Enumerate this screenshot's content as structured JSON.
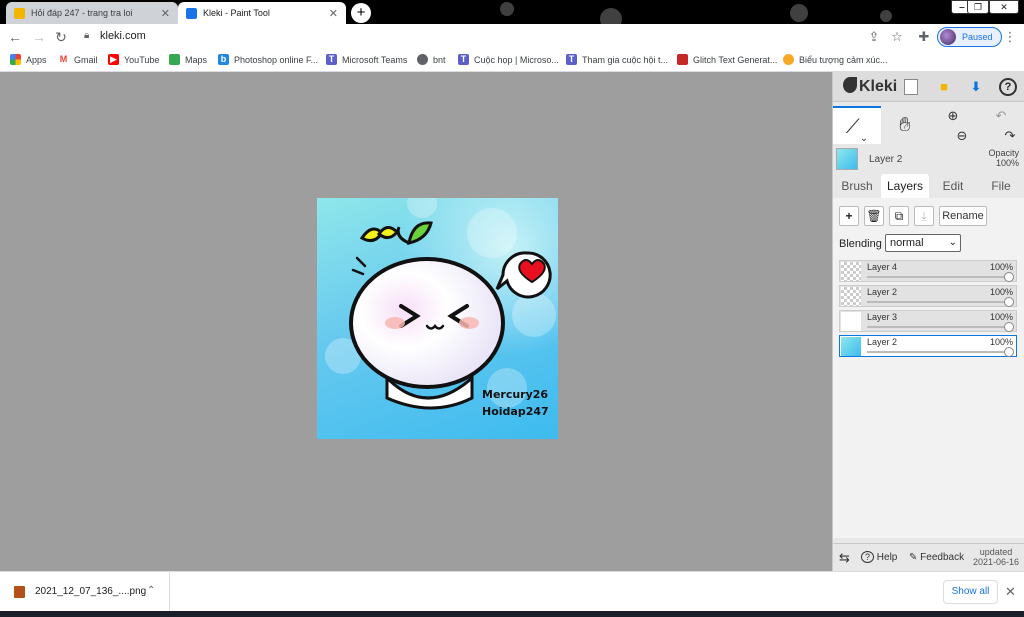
{
  "browser": {
    "tabs": [
      {
        "title": "Hỏi đáp 247 - trang tra loi",
        "active": false,
        "favicon_color": "#f2b600"
      },
      {
        "title": "Kleki - Paint Tool",
        "active": true,
        "favicon_color": "#1a73e8"
      }
    ],
    "url": "kleki.com",
    "profile_status": "Paused",
    "bookmarks": [
      {
        "label": "Apps",
        "icon": "apps-grid-icon",
        "color": "#ea4335"
      },
      {
        "label": "Gmail",
        "icon": "gmail-icon",
        "color": "#ea4335"
      },
      {
        "label": "YouTube",
        "icon": "youtube-icon",
        "color": "#ff0000"
      },
      {
        "label": "Maps",
        "icon": "maps-icon",
        "color": "#34a853"
      },
      {
        "label": "Photoshop online F...",
        "icon": "photoshop-icon",
        "color": "#1e88e5"
      },
      {
        "label": "Microsoft Teams",
        "icon": "teams-icon",
        "color": "#5b5fc7"
      },
      {
        "label": "bnt",
        "icon": "globe-icon",
        "color": "#5f6368"
      },
      {
        "label": "Cuộc họp | Microso...",
        "icon": "teams-icon",
        "color": "#5b5fc7"
      },
      {
        "label": "Tham gia cuộc hội t...",
        "icon": "teams-icon",
        "color": "#5b5fc7"
      },
      {
        "label": "Glitch Text Generat...",
        "icon": "glitch-icon",
        "color": "#c62828"
      },
      {
        "label": "Biểu tượng cảm xúc...",
        "icon": "emoji-icon",
        "color": "#f9a825"
      }
    ]
  },
  "artwork": {
    "signature_line1": "Mercury26",
    "signature_line2": "Hoidap247"
  },
  "kleki": {
    "logo": "Kleki",
    "current_layer": "Layer 2",
    "opacity_label": "Opacity",
    "opacity_value": "100%",
    "tabs": [
      "Brush",
      "Layers",
      "Edit",
      "File"
    ],
    "active_tab": "Layers",
    "rename_label": "Rename",
    "blending_label": "Blending",
    "blending_value": "normal",
    "layers": [
      {
        "name": "Layer 4",
        "opacity": "100%",
        "selected": false
      },
      {
        "name": "Layer 2",
        "opacity": "100%",
        "selected": false
      },
      {
        "name": "Layer 3",
        "opacity": "100%",
        "selected": false
      },
      {
        "name": "Layer 2",
        "opacity": "100%",
        "selected": true
      }
    ],
    "footer": {
      "help": "Help",
      "feedback": "Feedback",
      "updated_label": "updated",
      "updated_date": "2021-06-16"
    }
  },
  "downloads": {
    "filename": "2021_12_07_136_....png",
    "show_all": "Show all"
  }
}
